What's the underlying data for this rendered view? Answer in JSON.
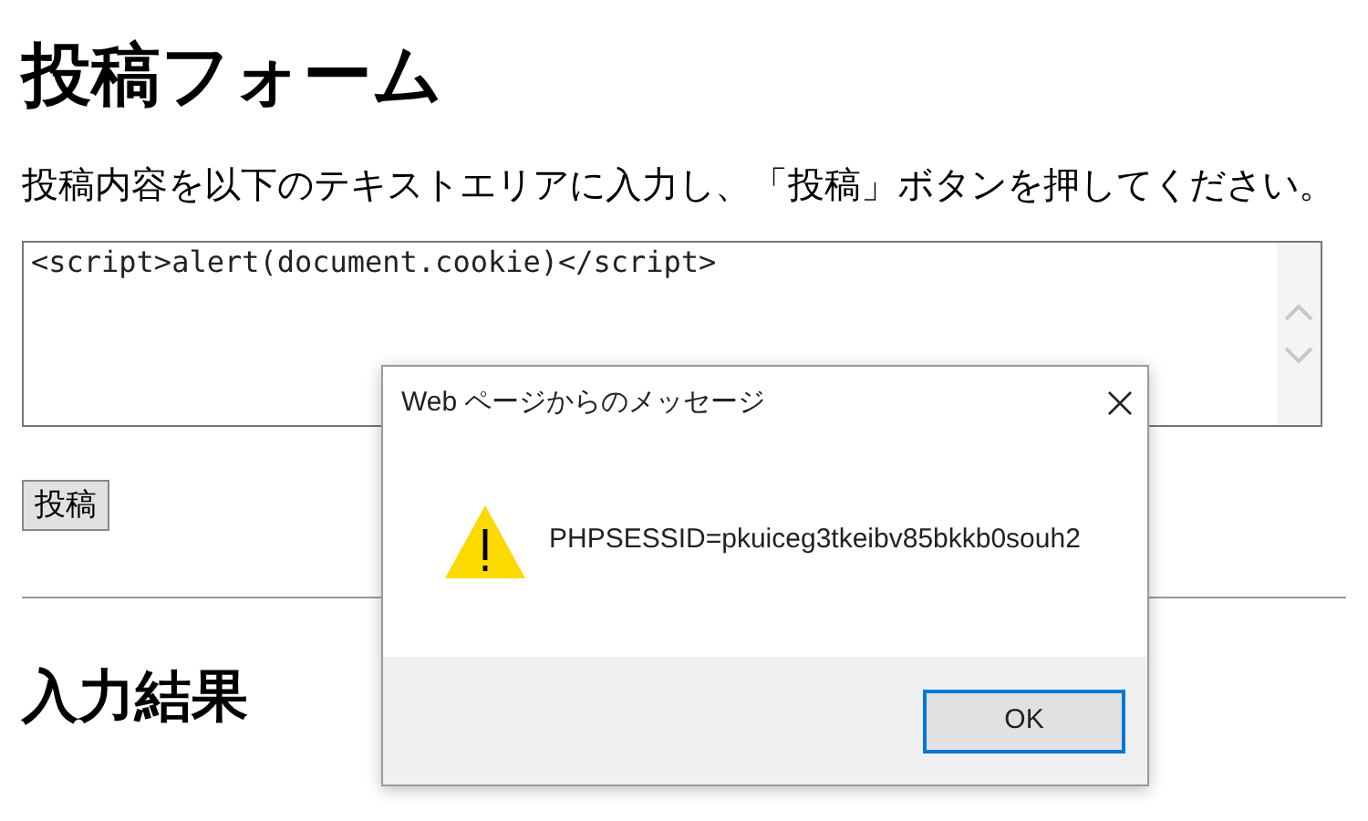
{
  "page": {
    "title": "投稿フォーム",
    "instructions": "投稿内容を以下のテキストエリアに入力し、「投稿」ボタンを押してください。",
    "post_field": {
      "value": "<script>alert(document.cookie)</script>"
    },
    "submit_button": "投稿",
    "result_heading": "入力結果"
  },
  "dialog": {
    "title": "Web ページからのメッセージ",
    "message": "PHPSESSID=pkuiceg3tkeibv85bkkb0souh2",
    "buttons": [
      {
        "label": "OK",
        "selected": true
      }
    ]
  }
}
